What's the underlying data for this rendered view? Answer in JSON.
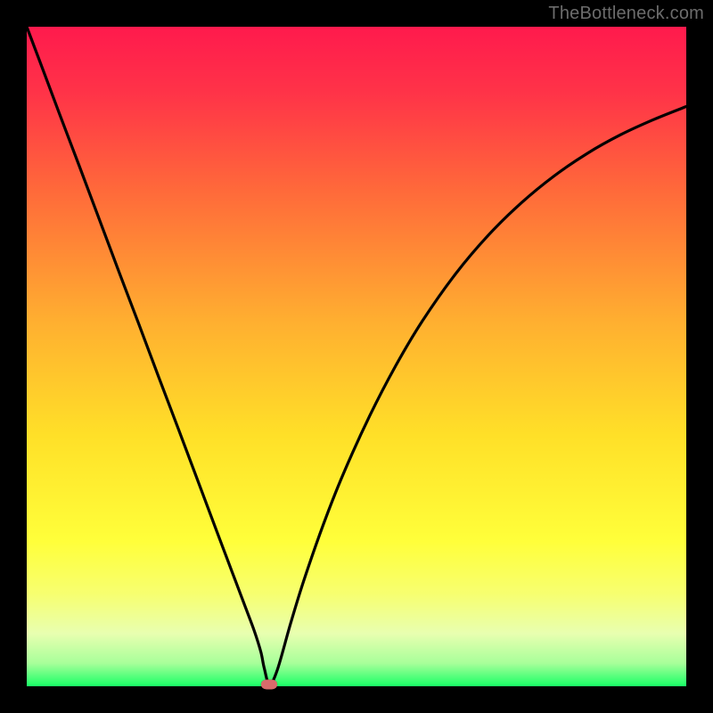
{
  "watermark": "TheBottleneck.com",
  "colors": {
    "frame_bg": "#000000",
    "watermark_text": "#6c6c6c",
    "curve_stroke": "#000000",
    "marker_fill": "#d96b6b",
    "gradient_stops": [
      {
        "offset": 0.0,
        "color": "#ff1a4d"
      },
      {
        "offset": 0.1,
        "color": "#ff3348"
      },
      {
        "offset": 0.25,
        "color": "#ff6a3a"
      },
      {
        "offset": 0.45,
        "color": "#ffb030"
      },
      {
        "offset": 0.62,
        "color": "#ffe028"
      },
      {
        "offset": 0.78,
        "color": "#ffff3a"
      },
      {
        "offset": 0.86,
        "color": "#f7ff70"
      },
      {
        "offset": 0.92,
        "color": "#e8ffb0"
      },
      {
        "offset": 0.965,
        "color": "#a8ff9a"
      },
      {
        "offset": 1.0,
        "color": "#19ff66"
      }
    ]
  },
  "chart_data": {
    "type": "line",
    "title": "",
    "xlabel": "",
    "ylabel": "",
    "xlim": [
      0,
      100
    ],
    "ylim": [
      0,
      100
    ],
    "grid": false,
    "legend": false,
    "x": [
      0,
      2,
      5,
      8,
      11,
      14,
      17,
      20,
      23,
      26,
      29,
      31,
      33,
      34.5,
      35.5,
      36,
      36.8,
      38,
      40,
      42,
      45,
      48,
      52,
      56,
      60,
      65,
      70,
      75,
      80,
      85,
      90,
      95,
      100
    ],
    "y": [
      100,
      94.7,
      86.7,
      78.8,
      70.8,
      62.8,
      54.9,
      46.9,
      39,
      31,
      23,
      17.7,
      12.4,
      8.4,
      5.2,
      2.8,
      0.3,
      2.5,
      9.5,
      16,
      24.6,
      32.2,
      41,
      48.7,
      55.4,
      62.5,
      68.4,
      73.3,
      77.4,
      80.8,
      83.6,
      85.9,
      87.9
    ],
    "marker": {
      "x": 36.8,
      "y": 0.3
    },
    "notes": "V-shaped bottleneck curve; minimum near x≈36.8. Values estimated from pixel positions within the 740×740 plot area."
  }
}
